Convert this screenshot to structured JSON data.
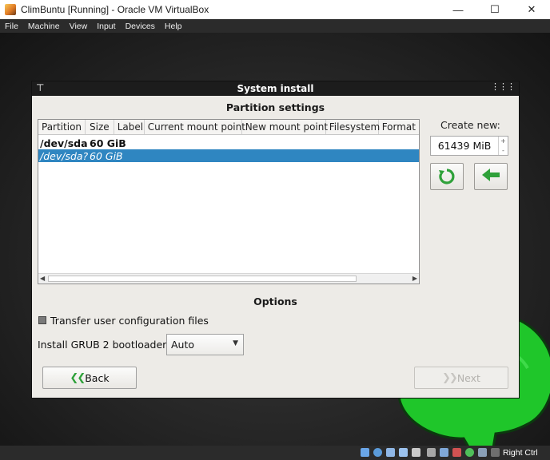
{
  "window": {
    "title": "ClimBuntu [Running] - Oracle VM VirtualBox",
    "minimize_icon": "minimize-icon",
    "maximize_icon": "maximize-icon",
    "close_icon": "close-icon"
  },
  "menu": {
    "items": [
      {
        "label": "File"
      },
      {
        "label": "Machine"
      },
      {
        "label": "View"
      },
      {
        "label": "Input"
      },
      {
        "label": "Devices"
      },
      {
        "label": "Help"
      }
    ]
  },
  "dialog": {
    "title": "System install",
    "partition_heading": "Partition settings",
    "columns": [
      "Partition",
      "Size",
      "Label",
      "Current mount point",
      "New mount point",
      "Filesystem",
      "Format"
    ],
    "rows": [
      {
        "partition": "/dev/sda",
        "size": "60 GiB",
        "selected": false
      },
      {
        "partition": "/dev/sda?",
        "size": "60 GiB",
        "selected": true
      }
    ],
    "create_new_label": "Create new:",
    "create_new_value": "61439 MiB",
    "options_heading": "Options",
    "transfer_label": "Transfer user configuration files",
    "transfer_checked": false,
    "grub_label": "Install GRUB 2 bootloader:",
    "grub_selected": "Auto",
    "back_label": "Back",
    "next_label": "Next",
    "next_enabled": false
  },
  "statusbar": {
    "host_key": "Right Ctrl"
  },
  "colors": {
    "selection": "#2f86c1",
    "accent_green": "#2fa13a",
    "desktop_green": "#22d12e"
  }
}
